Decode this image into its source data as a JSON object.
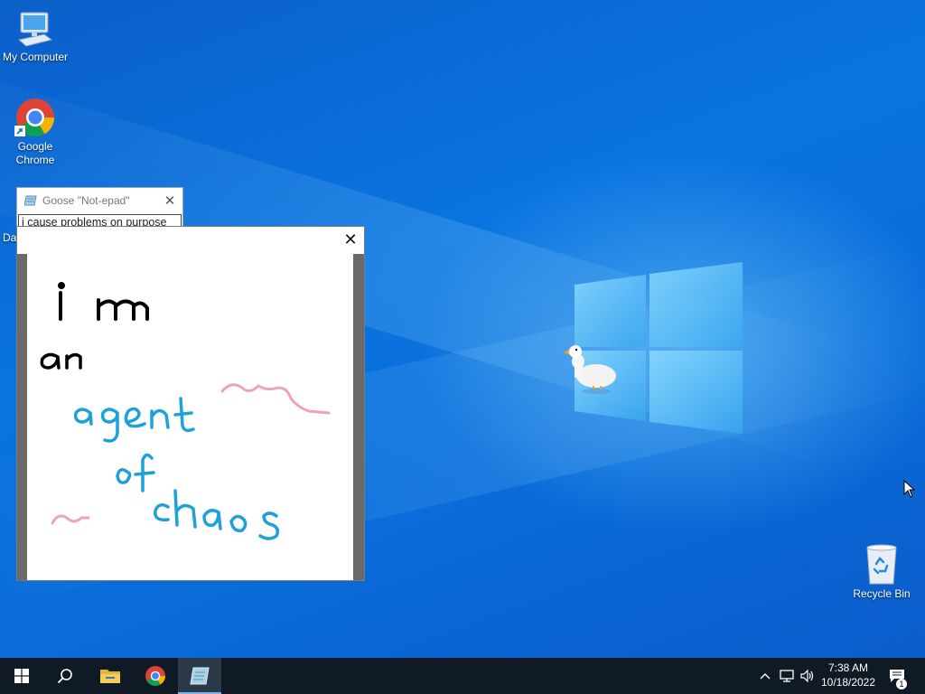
{
  "desktop": {
    "icons": {
      "my_computer": "My Computer",
      "chrome": "Google\nChrome",
      "recycle_bin": "Recycle Bin",
      "partial_label": "Da"
    }
  },
  "goose_notepad": {
    "title": "Goose \"Not-epad\"",
    "text": "i cause problems on purpose",
    "close_glyph": "✕"
  },
  "drawing_window": {
    "close_glyph": "✕",
    "drawing_words": [
      "i m",
      "an",
      "agent",
      "of",
      "chaos"
    ],
    "ink_colors": {
      "black": "#000000",
      "blue": "#1ea0d8",
      "pink": "#f0a2b8"
    }
  },
  "taskbar": {
    "buttons": [
      "start-icon",
      "search-icon",
      "file-explorer-icon",
      "chrome-icon",
      "notepad-icon"
    ],
    "active_button": "notepad-icon",
    "tray_icons": [
      "chevron-up-icon",
      "network-icon",
      "volume-icon"
    ],
    "time": "7:38 AM",
    "date": "10/18/2022",
    "notification_count": "1"
  },
  "colors": {
    "desktop_blue": "#0a6fd8",
    "taskbar": "#101a24",
    "accent": "#7eb6ea"
  }
}
